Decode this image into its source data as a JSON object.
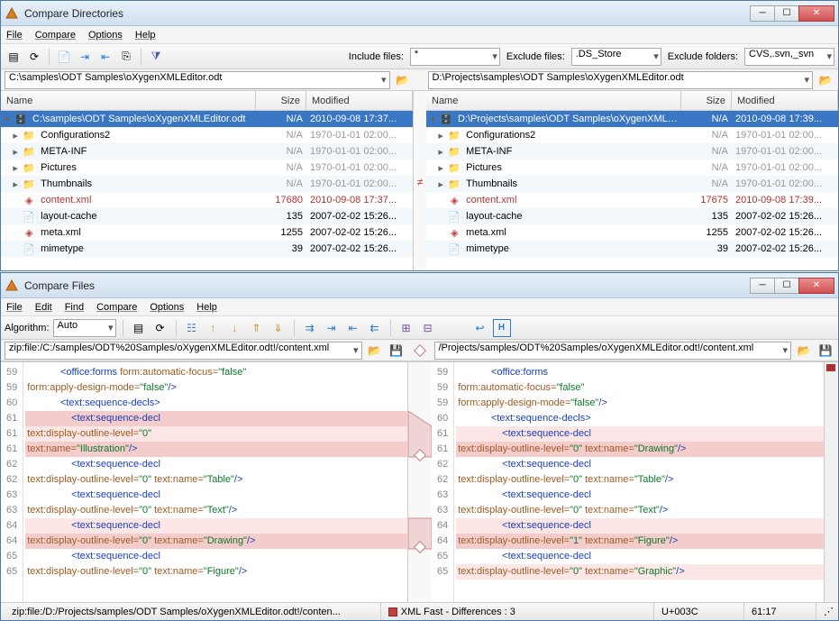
{
  "dir_window": {
    "title": "Compare Directories",
    "menu": [
      "File",
      "Compare",
      "Options",
      "Help"
    ],
    "filters": {
      "include_label": "Include files:",
      "include_value": "*",
      "exclude_files_label": "Exclude files:",
      "exclude_files_value": ".DS_Store",
      "exclude_folders_label": "Exclude folders:",
      "exclude_folders_value": "CVS,.svn,_svn"
    },
    "left": {
      "path": "C:\\samples\\ODT Samples\\oXygenXMLEditor.odt",
      "columns": [
        "Name",
        "Size",
        "Modified"
      ],
      "rows": [
        {
          "name": "C:\\samples\\ODT Samples\\oXygenXMLEditor.odt",
          "size": "N/A",
          "mod": "2010-09-08  17:37...",
          "type": "root",
          "sel": true,
          "exp": "▾"
        },
        {
          "name": "Configurations2",
          "size": "N/A",
          "mod": "1970-01-01  02:00...",
          "type": "folder",
          "exp": "▸",
          "muted": true
        },
        {
          "name": "META-INF",
          "size": "N/A",
          "mod": "1970-01-01  02:00...",
          "type": "folder",
          "exp": "▸",
          "muted": true
        },
        {
          "name": "Pictures",
          "size": "N/A",
          "mod": "1970-01-01  02:00...",
          "type": "folder",
          "exp": "▸",
          "muted": true
        },
        {
          "name": "Thumbnails",
          "size": "N/A",
          "mod": "1970-01-01  02:00...",
          "type": "folder",
          "exp": "▸",
          "muted": true
        },
        {
          "name": "content.xml",
          "size": "17680",
          "mod": "2010-09-08  17:37...",
          "type": "xml",
          "diff": true
        },
        {
          "name": "layout-cache",
          "size": "135",
          "mod": "2007-02-02  15:26...",
          "type": "file"
        },
        {
          "name": "meta.xml",
          "size": "1255",
          "mod": "2007-02-02  15:26...",
          "type": "xml"
        },
        {
          "name": "mimetype",
          "size": "39",
          "mod": "2007-02-02  15:26...",
          "type": "file"
        }
      ]
    },
    "right": {
      "path": "D:\\Projects\\samples\\ODT Samples\\oXygenXMLEditor.odt",
      "columns": [
        "Name",
        "Size",
        "Modified"
      ],
      "rows": [
        {
          "name": "D:\\Projects\\samples\\ODT Samples\\oXygenXMLEdito...",
          "size": "N/A",
          "mod": "2010-09-08  17:39...",
          "type": "root",
          "sel": true,
          "exp": "▾"
        },
        {
          "name": "Configurations2",
          "size": "N/A",
          "mod": "1970-01-01  02:00...",
          "type": "folder",
          "exp": "▸",
          "muted": true
        },
        {
          "name": "META-INF",
          "size": "N/A",
          "mod": "1970-01-01  02:00...",
          "type": "folder",
          "exp": "▸",
          "muted": true
        },
        {
          "name": "Pictures",
          "size": "N/A",
          "mod": "1970-01-01  02:00...",
          "type": "folder",
          "exp": "▸",
          "muted": true
        },
        {
          "name": "Thumbnails",
          "size": "N/A",
          "mod": "1970-01-01  02:00...",
          "type": "folder",
          "exp": "▸",
          "muted": true
        },
        {
          "name": "content.xml",
          "size": "17675",
          "mod": "2010-09-08  17:39...",
          "type": "xml",
          "diff": true
        },
        {
          "name": "layout-cache",
          "size": "135",
          "mod": "2007-02-02  15:26...",
          "type": "file"
        },
        {
          "name": "meta.xml",
          "size": "1255",
          "mod": "2007-02-02  15:26...",
          "type": "xml"
        },
        {
          "name": "mimetype",
          "size": "39",
          "mod": "2007-02-02  15:26...",
          "type": "file"
        }
      ]
    },
    "diff_marker": "≠"
  },
  "file_window": {
    "title": "Compare Files",
    "menu": [
      "File",
      "Edit",
      "Find",
      "Compare",
      "Options",
      "Help"
    ],
    "algo_label": "Algorithm:",
    "algo_value": "Auto",
    "left_path": "zip:file:/C:/samples/ODT%20Samples/oXygenXMLEditor.odt!/content.xml",
    "right_path": "/Projects/samples/ODT%20Samples/oXygenXMLEditor.odt!/content.xml",
    "left_lines": [
      {
        "n": "59",
        "html": "            <span class='tag-blue'>&lt;office:forms</span> <span class='tag-brown'>form:automatic-focus=</span><span class='tag-green'>\"false\"</span>"
      },
      {
        "n": "59",
        "html": "<span class='tag-brown'>form:apply-design-mode=</span><span class='tag-green'>\"false\"</span><span class='tag-blue'>/&gt;</span>"
      },
      {
        "n": "60",
        "html": "            <span class='tag-blue'>&lt;text:sequence-decls&gt;</span>"
      },
      {
        "n": "61",
        "html": "                <span class='tag-blue'>&lt;text:sequence-decl</span>",
        "cls": "hl-red"
      },
      {
        "n": "61",
        "html": "<span class='tag-brown'>text:display-outline-level=</span><span class='tag-green'>\"0\"</span>",
        "cls": "hl-pink"
      },
      {
        "n": "61",
        "html": "<span class='tag-brown'>text:name=</span><span class='tag-green'>\"Illustration\"</span><span class='tag-blue'>/&gt;</span>",
        "cls": "hl-red"
      },
      {
        "n": "62",
        "html": "                <span class='tag-blue'>&lt;text:sequence-decl</span>"
      },
      {
        "n": "62",
        "html": "<span class='tag-brown'>text:display-outline-level=</span><span class='tag-green'>\"0\"</span> <span class='tag-brown'>text:name=</span><span class='tag-green'>\"Table\"</span><span class='tag-blue'>/&gt;</span>"
      },
      {
        "n": "63",
        "html": "                <span class='tag-blue'>&lt;text:sequence-decl</span>"
      },
      {
        "n": "63",
        "html": "<span class='tag-brown'>text:display-outline-level=</span><span class='tag-green'>\"0\"</span> <span class='tag-brown'>text:name=</span><span class='tag-green'>\"Text\"</span><span class='tag-blue'>/&gt;</span>"
      },
      {
        "n": "64",
        "html": "                <span class='tag-blue'>&lt;text:sequence-decl</span>",
        "cls": "hl-pink"
      },
      {
        "n": "64",
        "html": "<span class='tag-brown'>text:display-outline-level=</span><span class='tag-green'>\"0\"</span> <span class='tag-brown'>text:name=</span><span class='tag-green'>\"Drawing\"</span><span class='tag-blue'>/&gt;</span>",
        "cls": "hl-red"
      },
      {
        "n": "65",
        "html": "                <span class='tag-blue'>&lt;text:sequence-decl</span>"
      },
      {
        "n": "65",
        "html": "<span class='tag-brown'>text:display-outline-level=</span><span class='tag-green'>\"0\"</span> <span class='tag-brown'>text:name=</span><span class='tag-green'>\"Figure\"</span><span class='tag-blue'>/&gt;</span>"
      }
    ],
    "right_lines": [
      {
        "n": "59",
        "html": "            <span class='tag-blue'>&lt;office:forms</span>"
      },
      {
        "n": "59",
        "html": "<span class='tag-brown'>form:automatic-focus=</span><span class='tag-green'>\"false\"</span>"
      },
      {
        "n": "59",
        "html": "<span class='tag-brown'>form:apply-design-mode=</span><span class='tag-green'>\"false\"</span><span class='tag-blue'>/&gt;</span>"
      },
      {
        "n": "60",
        "html": "            <span class='tag-blue'>&lt;text:sequence-decls&gt;</span>"
      },
      {
        "n": "61",
        "html": "                <span class='tag-blue'>&lt;text:sequence-decl</span>",
        "cls": "hl-pink"
      },
      {
        "n": "61",
        "html": "<span class='tag-brown'>text:display-outline-level=</span><span class='tag-green'>\"0\"</span> <span class='tag-brown'>text:name=</span><span class='tag-green'>\"Drawing\"</span><span class='tag-blue'>/&gt;</span>",
        "cls": "hl-red"
      },
      {
        "n": "62",
        "html": "                <span class='tag-blue'>&lt;text:sequence-decl</span>"
      },
      {
        "n": "62",
        "html": "<span class='tag-brown'>text:display-outline-level=</span><span class='tag-green'>\"0\"</span> <span class='tag-brown'>text:name=</span><span class='tag-green'>\"Table\"</span><span class='tag-blue'>/&gt;</span>"
      },
      {
        "n": "63",
        "html": "                <span class='tag-blue'>&lt;text:sequence-decl</span>"
      },
      {
        "n": "63",
        "html": "<span class='tag-brown'>text:display-outline-level=</span><span class='tag-green'>\"0\"</span> <span class='tag-brown'>text:name=</span><span class='tag-green'>\"Text\"</span><span class='tag-blue'>/&gt;</span>"
      },
      {
        "n": "64",
        "html": "                <span class='tag-blue'>&lt;text:sequence-decl</span>",
        "cls": "hl-pink"
      },
      {
        "n": "64",
        "html": "<span class='tag-brown'>text:display-outline-level=</span><span class='tag-green'>\"1\"</span> <span class='tag-brown'>text:name=</span><span class='tag-green'>\"Figure\"</span><span class='tag-blue'>/&gt;</span>",
        "cls": "hl-red"
      },
      {
        "n": "65",
        "html": "                <span class='tag-blue'>&lt;text:sequence-decl</span>"
      },
      {
        "n": "65",
        "html": "<span class='tag-brown'>text:display-outline-level=</span><span class='tag-green'>\"0\"</span> <span class='tag-brown'>text:name=</span><span class='tag-green'>\"Graphic\"</span><span class='tag-blue'>/&gt;</span>",
        "cls": "hl-pink"
      }
    ],
    "status": {
      "path": "zip:file:/D:/Projects/samples/ODT Samples/oXygenXMLEditor.odt!/conten...",
      "mode": "XML Fast - Differences : 3",
      "char": "U+003C",
      "pos": "61:17"
    }
  }
}
